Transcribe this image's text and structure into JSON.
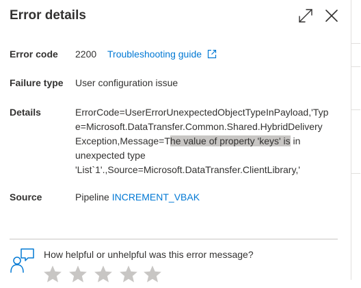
{
  "panel": {
    "title": "Error details",
    "expand_icon": "expand-icon",
    "close_icon": "close-icon"
  },
  "error_code": {
    "label": "Error code",
    "value": "2200",
    "troubleshooting_link": "Troubleshooting guide",
    "link_icon": "open-in-new-icon"
  },
  "failure_type": {
    "label": "Failure type",
    "value": "User configuration issue"
  },
  "details": {
    "label": "Details",
    "line1": "ErrorCode=UserErrorUnexpectedObjectTypeInPayload,'Typ",
    "line2": "e=Microsoft.DataTransfer.Common.Shared.HybridDelivery",
    "line3_before": "Exception,Message=T",
    "line3_highlight": "he value of property 'keys' is",
    "line3_after": " in",
    "line4": "unexpected type",
    "line5": "'List`1'.,Source=Microsoft.DataTransfer.ClientLibrary,'"
  },
  "source": {
    "label": "Source",
    "prefix": "Pipeline ",
    "pipeline_link": "INCREMENT_VBAK"
  },
  "feedback": {
    "icon": "feedback-person-icon",
    "question": "How helpful or unhelpful was this error message?",
    "star_icon": "star-icon",
    "star_count": 5,
    "rating": 0
  },
  "colors": {
    "link": "#0078d4",
    "text": "#323130",
    "highlight": "#c8c6c4",
    "star": "#c8c6c4"
  }
}
